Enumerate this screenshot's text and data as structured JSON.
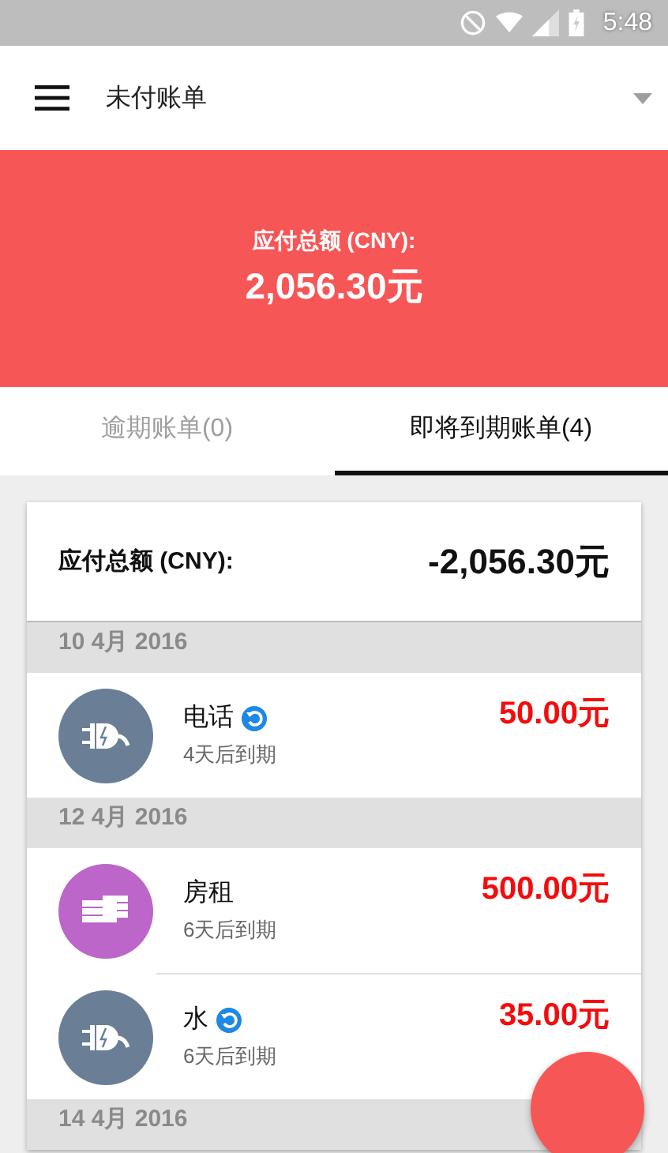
{
  "status_bar": {
    "time": "5:48"
  },
  "app_bar": {
    "title": "未付账单"
  },
  "summary": {
    "label": "应付总额 (CNY):",
    "amount": "2,056.30元"
  },
  "tabs": [
    {
      "label": "逾期账单(0)",
      "selected": false
    },
    {
      "label": "即将到期账单(4)",
      "selected": true
    }
  ],
  "card": {
    "total_label": "应付总额 (CNY):",
    "total_amount": "-2,056.30元",
    "groups": [
      {
        "date": "10 4月 2016",
        "bills": [
          {
            "name": "电话",
            "due": "4天后到期",
            "amount": "50.00元",
            "recurring": true,
            "kind": "plug",
            "color": "#6a7f96"
          }
        ]
      },
      {
        "date": "12 4月 2016",
        "bills": [
          {
            "name": "房租",
            "due": "6天后到期",
            "amount": "500.00元",
            "recurring": false,
            "kind": "money",
            "color": "#bb66c8"
          },
          {
            "name": "水",
            "due": "6天后到期",
            "amount": "35.00元",
            "recurring": true,
            "kind": "plug",
            "color": "#6a7f96"
          }
        ]
      },
      {
        "date": "14 4月 2016"
      }
    ]
  }
}
